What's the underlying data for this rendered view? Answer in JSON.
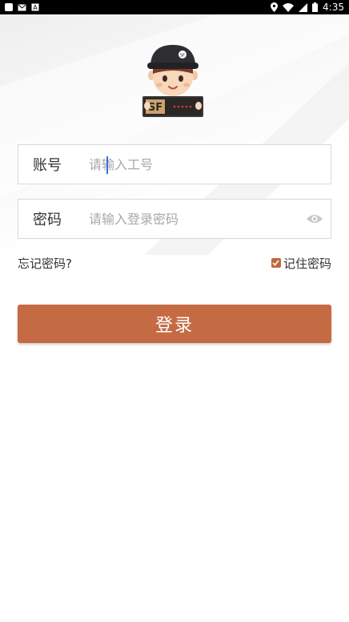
{
  "status_bar": {
    "time": "4:35",
    "icons": [
      "notification-square-icon",
      "mail-icon",
      "a-icon",
      "location-icon",
      "wifi-icon",
      "signal-icon",
      "battery-icon"
    ]
  },
  "login": {
    "account": {
      "label": "账号",
      "placeholder": "请输入工号"
    },
    "password": {
      "label": "密码",
      "placeholder": "请输入登录密码",
      "toggle_icon": "eye-icon"
    },
    "forgot_label": "忘记密码?",
    "remember": {
      "label": "记住密码",
      "checked": true
    },
    "submit_label": "登录"
  },
  "mascot": {
    "badge_text": "SF"
  },
  "colors": {
    "accent": "#c56b43",
    "status_bar": "#000000"
  }
}
